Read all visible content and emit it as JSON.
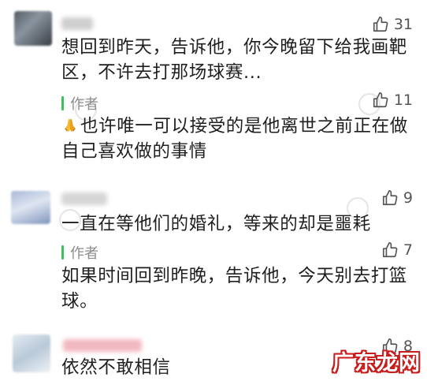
{
  "comments": [
    {
      "likes": "31",
      "lines": [
        "想回到昨天，告诉他，你今晚留下给我画靶",
        "区，不许去打那场球赛..."
      ]
    },
    {
      "likes": "11",
      "author_tag": "作者",
      "lines": [
        "也许唯一可以接受的是他离世之前正在做",
        "自己喜欢做的事情"
      ]
    },
    {
      "likes": "9",
      "lines": [
        "一直在等他们的婚礼，等来的却是噩耗"
      ]
    },
    {
      "likes": "7",
      "author_tag": "作者",
      "lines": [
        "如果时间回到昨晚，告诉他，今天别去打篮",
        "球。"
      ]
    },
    {
      "likes": "8",
      "lines": [
        "依然不敢相信"
      ]
    }
  ],
  "watermark": {
    "brand": "广东龙网"
  },
  "colors": {
    "author_bar": "#3fbf5f",
    "logo_red": "#c81e1e"
  }
}
